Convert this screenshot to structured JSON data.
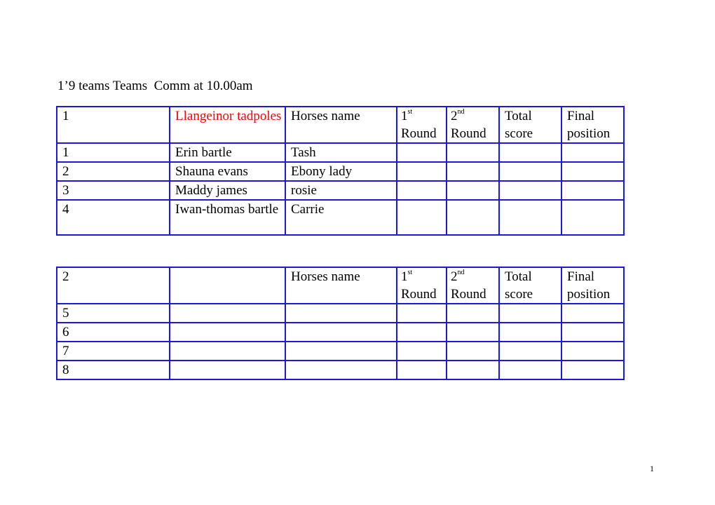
{
  "document": {
    "title": "1’9 teams Teams  Comm at 10.00am",
    "page_number": "1",
    "colors": {
      "border": "#1a1adf",
      "team_name": "#ff0000"
    }
  },
  "header_labels": {
    "horses_name": "Horses name",
    "round1_num": "1",
    "round1_sup": "st",
    "round1_word": "Round",
    "round2_num": "2",
    "round2_sup": "nd",
    "round2_word": "Round",
    "total": "Total score",
    "final": "Final position"
  },
  "tables": [
    {
      "team_number": "1",
      "team_name": "Llangeinor tadpoles",
      "rows": [
        {
          "num": "1",
          "rider": "Erin bartle",
          "horse": "Tash",
          "round1": "",
          "round2": "",
          "total": "",
          "final": ""
        },
        {
          "num": "2",
          "rider": "Shauna evans",
          "horse": "Ebony lady",
          "round1": "",
          "round2": "",
          "total": "",
          "final": ""
        },
        {
          "num": "3",
          "rider": "Maddy james",
          "horse": "rosie",
          "round1": "",
          "round2": "",
          "total": "",
          "final": ""
        },
        {
          "num": "4",
          "rider": "Iwan-thomas bartle",
          "horse": "Carrie",
          "round1": "",
          "round2": "",
          "total": "",
          "final": ""
        }
      ]
    },
    {
      "team_number": "2",
      "team_name": "",
      "rows": [
        {
          "num": "5",
          "rider": "",
          "horse": "",
          "round1": "",
          "round2": "",
          "total": "",
          "final": ""
        },
        {
          "num": "6",
          "rider": "",
          "horse": "",
          "round1": "",
          "round2": "",
          "total": "",
          "final": ""
        },
        {
          "num": "7",
          "rider": "",
          "horse": "",
          "round1": "",
          "round2": "",
          "total": "",
          "final": ""
        },
        {
          "num": "8",
          "rider": "",
          "horse": "",
          "round1": "",
          "round2": "",
          "total": "",
          "final": ""
        }
      ]
    }
  ]
}
